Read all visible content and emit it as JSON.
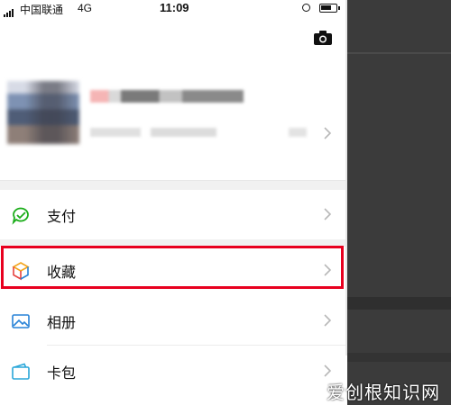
{
  "status_bar": {
    "carrier": "中国联通",
    "network": "4G",
    "time": "11:09"
  },
  "menu": {
    "pay": {
      "label": "支付",
      "icon": "wechat-pay-icon"
    },
    "favorites": {
      "label": "收藏",
      "icon": "cube-icon"
    },
    "album": {
      "label": "相册",
      "icon": "picture-icon"
    },
    "cards": {
      "label": "卡包",
      "icon": "wallet-icon"
    }
  },
  "highlight_color": "#e8001f",
  "watermark": "爱创根知识网"
}
